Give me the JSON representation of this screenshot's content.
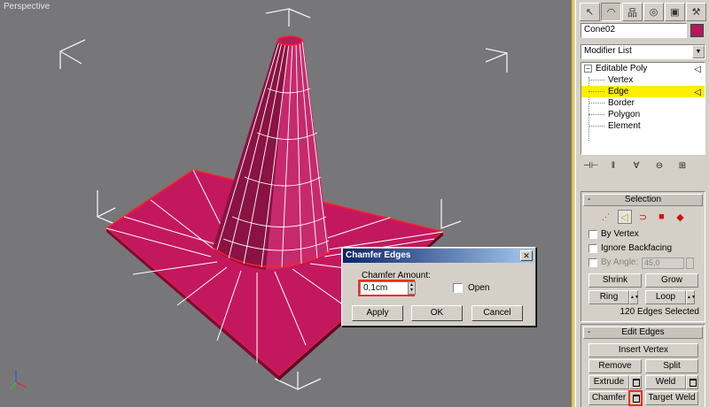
{
  "viewport": {
    "label": "Perspective",
    "object_color": "#b5185c"
  },
  "panel": {
    "tabs": [
      {
        "name": "create-tab",
        "glyph": "↖"
      },
      {
        "name": "modify-tab",
        "glyph": "◠"
      },
      {
        "name": "hierarchy-tab",
        "glyph": "品"
      },
      {
        "name": "motion-tab",
        "glyph": "◎"
      },
      {
        "name": "display-tab",
        "glyph": "▣"
      },
      {
        "name": "utilities-tab",
        "glyph": "⚒"
      }
    ],
    "object_name": "Cone02",
    "object_color": "#b5185c",
    "modifier_list": "Modifier List",
    "stack": {
      "top": "Editable Poly",
      "items": [
        "Vertex",
        "Edge",
        "Border",
        "Polygon",
        "Element"
      ],
      "selected": "Edge"
    },
    "stack_tools": [
      "⊣⊢",
      "ǁ",
      "∀",
      "⊖",
      "⊞"
    ],
    "selection": {
      "title": "Selection",
      "by_vertex": "By Vertex",
      "ignore_backfacing": "Ignore Backfacing",
      "by_angle": "By Angle:",
      "angle_value": "45,0",
      "shrink": "Shrink",
      "grow": "Grow",
      "ring": "Ring",
      "loop": "Loop",
      "status": "120 Edges Selected"
    },
    "edit_edges": {
      "title": "Edit Edges",
      "insert_vertex": "Insert Vertex",
      "remove": "Remove",
      "split": "Split",
      "extrude": "Extrude",
      "weld": "Weld",
      "chamfer": "Chamfer",
      "target_weld": "Target Weld"
    },
    "rollout_sign": "-"
  },
  "dialog": {
    "title": "Chamfer Edges",
    "close": "✕",
    "amount_label": "Chamfer Amount:",
    "amount_value": "0,1cm",
    "open_label": "Open",
    "apply": "Apply",
    "ok": "OK",
    "cancel": "Cancel"
  }
}
